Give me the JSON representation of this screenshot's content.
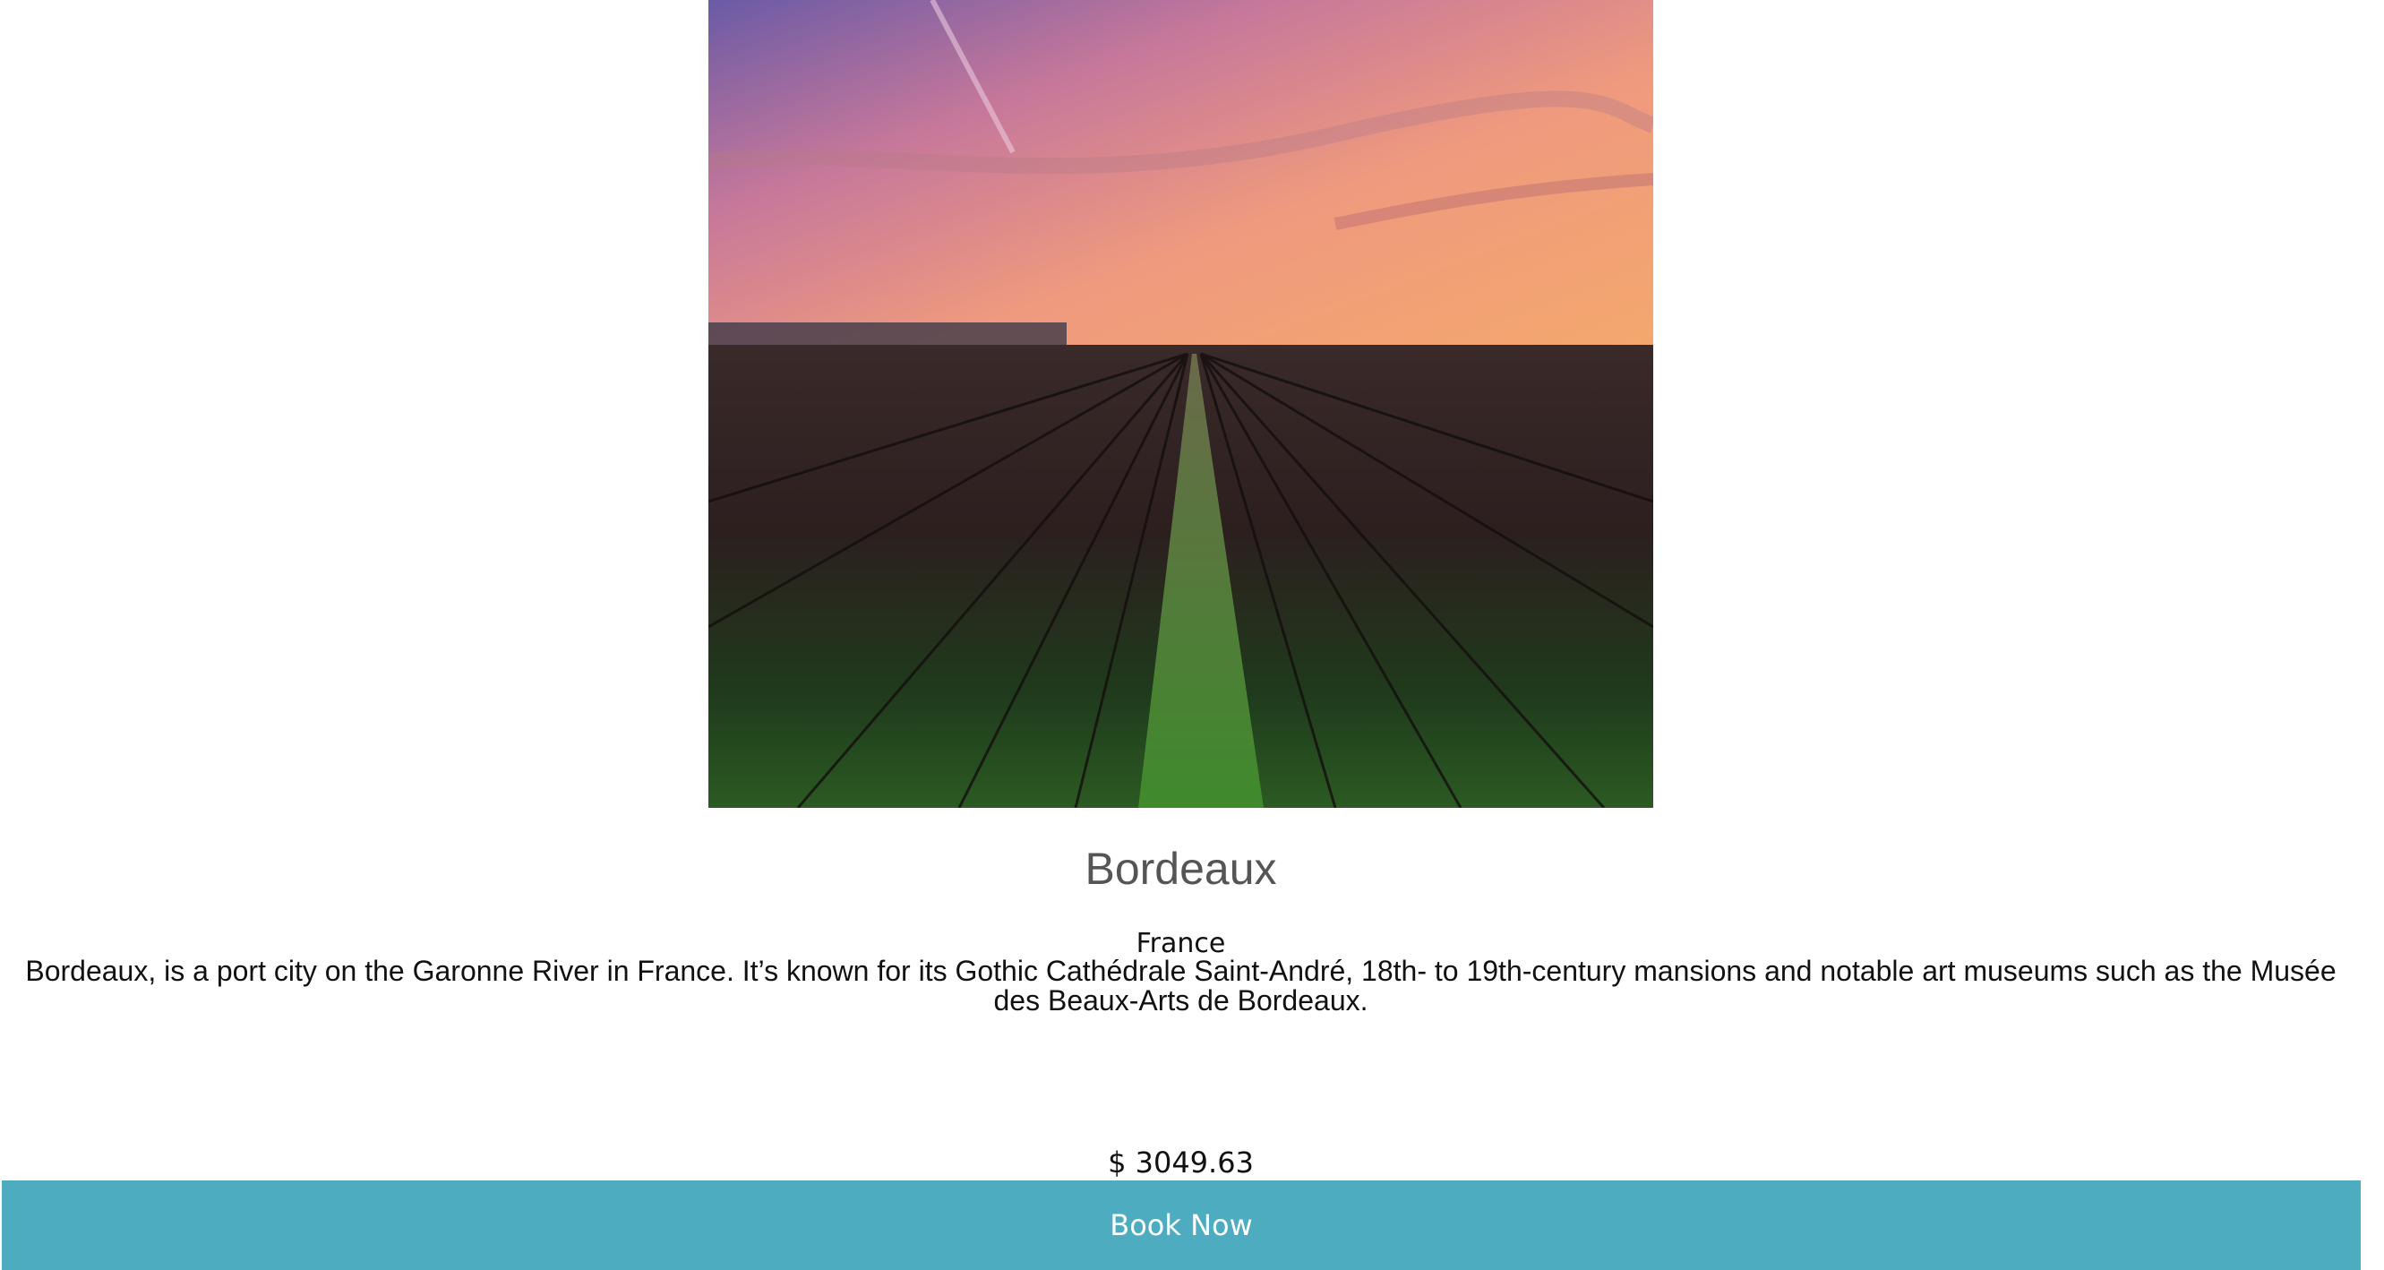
{
  "destination": {
    "name": "Bordeaux",
    "country": "France",
    "description": "Bordeaux, is a port city on the Garonne River in France. It’s known for its Gothic Cathédrale Saint-André, 18th- to 19th-century mansions and notable art museums such as the Musée des Beaux-Arts de Bordeaux.",
    "price": "$ 3049.63",
    "book_label": "Book Now"
  },
  "colors": {
    "button_bg": "#4eacc1",
    "title": "#555555",
    "text": "#111111"
  }
}
